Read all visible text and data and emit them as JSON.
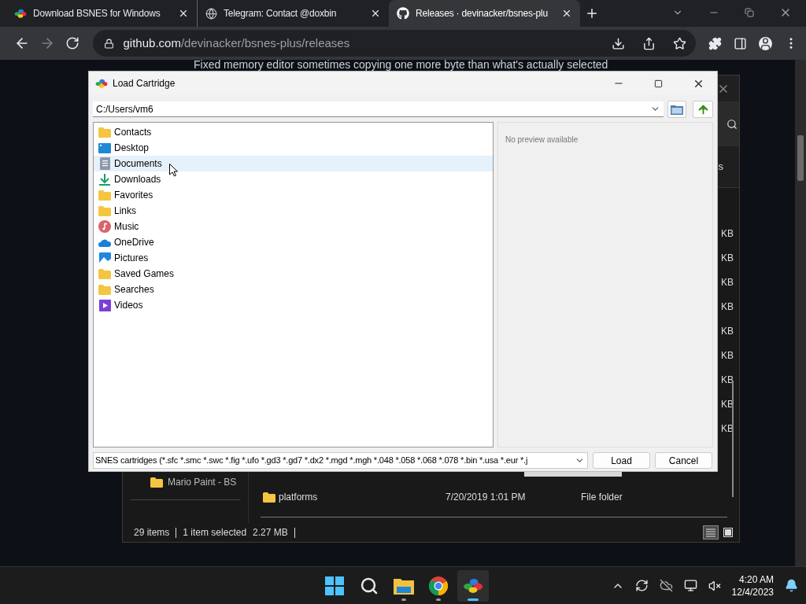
{
  "browser": {
    "tabs": [
      {
        "kind": "bsnes",
        "title": "Download BSNES for Windows",
        "selected": false
      },
      {
        "kind": "globe",
        "title": "Telegram: Contact @doxbin",
        "selected": false
      },
      {
        "kind": "github",
        "title": "Releases · devinacker/bsnes-plu",
        "selected": true
      }
    ],
    "nav_buttons": [
      {
        "kind": "back",
        "disabled": false
      },
      {
        "kind": "forward",
        "disabled": true
      },
      {
        "kind": "reload",
        "disabled": false
      }
    ],
    "url": {
      "host": "github.com",
      "path": "/devinacker/bsnes-plus/releases"
    }
  },
  "page": {
    "text": "Fixed memory editor sometimes copying one more byte than what's actually selected"
  },
  "explorer": {
    "command_fragment": "s",
    "sizes": [
      "KB",
      "KB",
      "KB",
      "KB",
      "KB",
      "KB",
      "KB",
      "KB",
      "KB"
    ],
    "nav_item": "Mario Paint - BS",
    "rows": [
      {
        "name": "platforms",
        "date": "7/20/2019 1:01 PM",
        "type": "File folder"
      }
    ],
    "status": {
      "count": "29 items",
      "selection": "1 item selected",
      "size": "2.27 MB"
    },
    "views": [
      {
        "kind": "details",
        "selected": true
      },
      {
        "kind": "tiles",
        "selected": false
      }
    ]
  },
  "dialog": {
    "title": "Load Cartridge",
    "path": "C:/Users/vm6",
    "items": [
      {
        "kind": "folder",
        "name": "Contacts",
        "highlighted": false
      },
      {
        "kind": "desktop",
        "name": "Desktop",
        "highlighted": false
      },
      {
        "kind": "documents",
        "name": "Documents",
        "highlighted": true
      },
      {
        "kind": "downloads",
        "name": "Downloads",
        "highlighted": false
      },
      {
        "kind": "folder",
        "name": "Favorites",
        "highlighted": false
      },
      {
        "kind": "folder",
        "name": "Links",
        "highlighted": false
      },
      {
        "kind": "music",
        "name": "Music",
        "highlighted": false
      },
      {
        "kind": "onedrive",
        "name": "OneDrive",
        "highlighted": false
      },
      {
        "kind": "pictures",
        "name": "Pictures",
        "highlighted": false
      },
      {
        "kind": "folder",
        "name": "Saved Games",
        "highlighted": false
      },
      {
        "kind": "folder",
        "name": "Searches",
        "highlighted": false
      },
      {
        "kind": "videos",
        "name": "Videos",
        "highlighted": false
      }
    ],
    "preview": "No preview available",
    "filter": "SNES cartridges (*.sfc *.smc *.swc *.fig *.ufo *.gd3 *.gd7 *.dx2 *.mgd *.mgh *.048 *.058 *.068 *.078 *.bin *.usa *.eur *.j",
    "buttons": [
      "Load",
      "Cancel"
    ]
  },
  "taskbar": {
    "apps": [
      {
        "kind": "start",
        "running": false,
        "active": false
      },
      {
        "kind": "search",
        "running": false,
        "active": false
      },
      {
        "kind": "explorer",
        "running": true,
        "active": false
      },
      {
        "kind": "chrome",
        "running": true,
        "active": false
      },
      {
        "kind": "bsnes",
        "running": true,
        "active": true
      }
    ],
    "clock": {
      "time": "4:20 AM",
      "date": "12/4/2023"
    }
  }
}
